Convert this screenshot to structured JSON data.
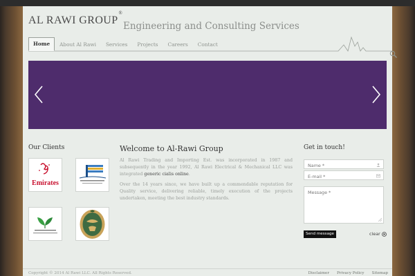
{
  "header": {
    "logo": "AL RAWI GROUP",
    "logo_mark": "®",
    "tagline": "Engineering and Consulting Services"
  },
  "nav": {
    "items": [
      {
        "label": "Home",
        "active": true
      },
      {
        "label": "About Al Rawi"
      },
      {
        "label": "Services"
      },
      {
        "label": "Projects"
      },
      {
        "label": "Careers"
      },
      {
        "label": "Contact"
      }
    ],
    "search_icon": "search-icon"
  },
  "slider": {
    "background": "#4e2c6c",
    "prev_icon": "chevron-left-icon",
    "next_icon": "chevron-right-icon"
  },
  "clients": {
    "title": "Our Clients",
    "logos": [
      {
        "text": "Emirates"
      },
      {
        "text": ""
      },
      {
        "text": ""
      },
      {
        "text": ""
      }
    ]
  },
  "welcome": {
    "title": "Welcome to Al-Rawi Group",
    "p1_before": "Al Rawi Trading and Importing Est. was incorporated in 1987 and subsequently in the year 1992, Al Rawi Electrical & Mechanical LLC was integrated ",
    "p1_link": "generic cialis online",
    "p1_after": ".",
    "p2": "Over the 14 years since, we have built up a commendable reputation for Quality service, delivering reliable, timely execution of the projects undertaken, meeting the best industry standards."
  },
  "contact": {
    "title": "Get in touch!",
    "name_placeholder": "Name *",
    "email_placeholder": "E-mail *",
    "message_placeholder": "Message *",
    "send_label": "Send message",
    "clear_label": "clear"
  },
  "footer": {
    "copyright": "Copyright © 2014 Al Rawi LLC. All Rights Reserved.",
    "links": [
      "Disclaimer",
      "Privacy Policy",
      "Sitemap"
    ]
  }
}
